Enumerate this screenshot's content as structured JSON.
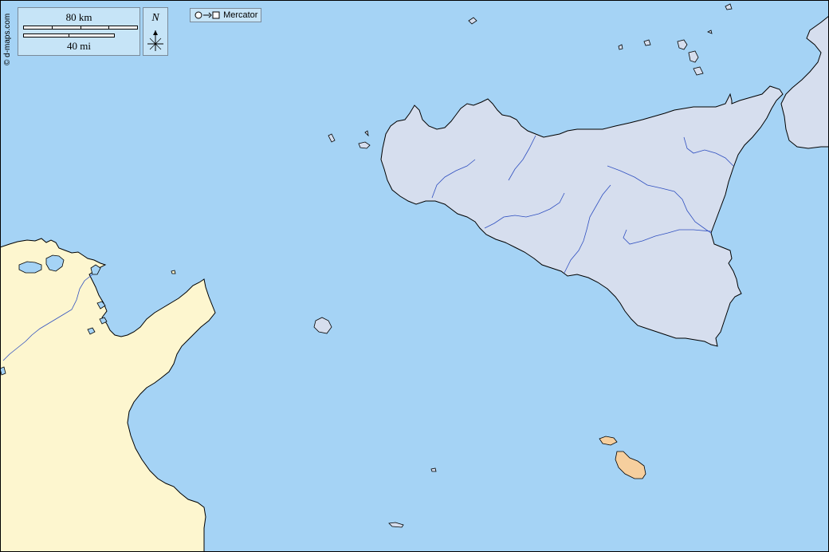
{
  "credit": "© d-maps.com",
  "scale": {
    "km_label": "80 km",
    "mi_label": "40 mi"
  },
  "north_label": "N",
  "projection": {
    "label": "Mercator",
    "icon": "circle-to-square-icon"
  },
  "colors": {
    "sea": "#a5d3f5",
    "sicily_italy": "#d6deee",
    "tunisia": "#fdf6cf",
    "malta": "#f6cf9e",
    "river": "#3050c0",
    "lake": "#a5d3f5"
  }
}
